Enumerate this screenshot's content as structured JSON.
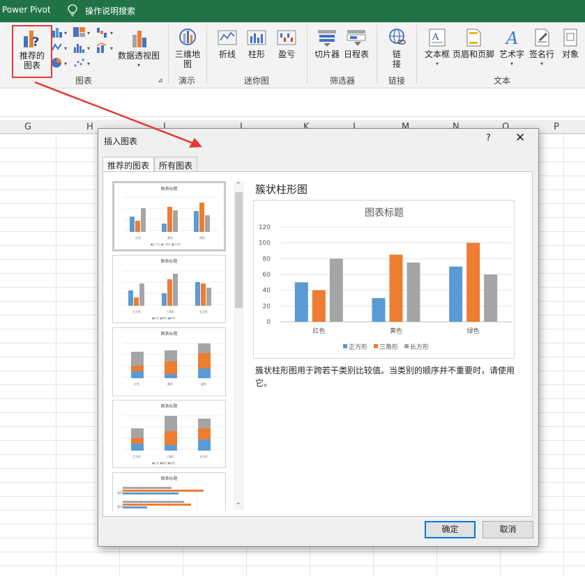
{
  "app": {
    "title": "Power Pivot",
    "search_label": "操作说明搜索"
  },
  "ribbon": {
    "recommended_chart": "推荐的\n图表",
    "pivot_chart": "数据透视图",
    "map_3d": "三维地\n图",
    "sparkline_line": "折线",
    "sparkline_column": "柱形",
    "sparkline_winloss": "盈亏",
    "slicer": "切片器",
    "timeline": "日程表",
    "link": "链\n接",
    "textbox": "文本框",
    "header_footer": "页眉和页脚",
    "wordart": "艺术字",
    "signature_line": "签名行",
    "object": "对象",
    "groups": {
      "charts": "图表",
      "tours": "演示",
      "sparklines": "迷你图",
      "filters": "筛选器",
      "links": "链接",
      "text": "文本"
    }
  },
  "columns": [
    "G",
    "H",
    "I",
    "J",
    "K",
    "L",
    "M",
    "N",
    "O",
    "P"
  ],
  "dialog": {
    "title": "插入图表",
    "help": "?",
    "close": "✕",
    "tabs": [
      "推荐的图表",
      "所有图表"
    ],
    "chart_name": "簇状柱形图",
    "description": "簇状柱形图用于跨若干类别比较值。当类别的顺序并不重要时，请使用它。",
    "ok": "确定",
    "cancel": "取消"
  },
  "chart_data": {
    "type": "bar",
    "title": "图表标题",
    "categories": [
      "红色",
      "黄色",
      "绿色"
    ],
    "series": [
      {
        "name": "正方形",
        "values": [
          50,
          30,
          70
        ],
        "color": "#5b9bd5"
      },
      {
        "name": "三角形",
        "values": [
          40,
          85,
          100
        ],
        "color": "#ed7d31"
      },
      {
        "name": "长方形",
        "values": [
          80,
          75,
          60
        ],
        "color": "#a5a5a5"
      }
    ],
    "ylim": [
      0,
      120
    ],
    "yticks": [
      0,
      20,
      40,
      60,
      80,
      100,
      120
    ],
    "legend": "bottom",
    "grid": true
  },
  "thumbnail_titles": [
    "图表标题",
    "图表标题",
    "图表标题",
    "图表标题",
    "图表标题"
  ]
}
